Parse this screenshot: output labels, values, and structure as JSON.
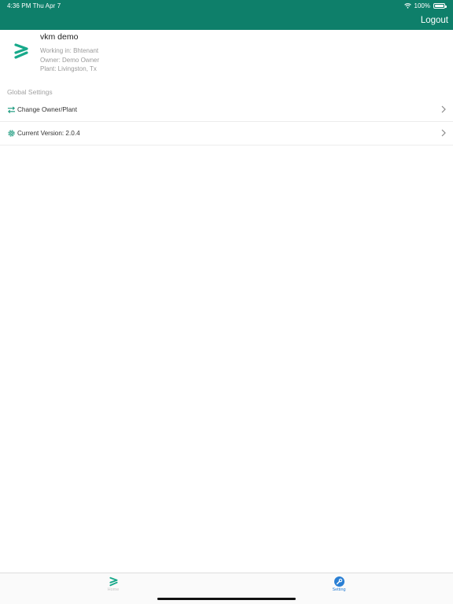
{
  "status_bar": {
    "time": "4:36 PM   Thu Apr 7",
    "battery": "100%",
    "battery_level": 1.0
  },
  "header": {
    "logout_label": "Logout"
  },
  "profile": {
    "name": "vkm demo",
    "working_in": "Working in: Bhtenant",
    "owner": "Owner: Demo Owner",
    "plant": "Plant: Livingston, Tx"
  },
  "settings": {
    "section_title": "Global Settings",
    "items": [
      {
        "label": "Change Owner/Plant",
        "icon": "swap-arrows-icon"
      },
      {
        "label": "Current Version: 2.0.4",
        "icon": "gear-icon"
      }
    ]
  },
  "tabbar": {
    "tabs": [
      {
        "label": "Home",
        "icon": "brand-logo-icon",
        "active": false
      },
      {
        "label": "Setting",
        "icon": "wrench-icon",
        "active": true
      }
    ]
  },
  "colors": {
    "header": "#0e7f6a",
    "brand": "#17a98a",
    "active_tab": "#2a7fd4"
  }
}
